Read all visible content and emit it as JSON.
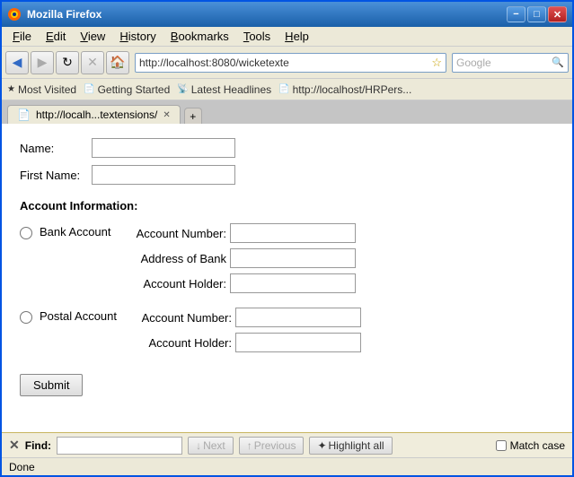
{
  "window": {
    "title": "Mozilla Firefox",
    "minimize_label": "−",
    "maximize_label": "□",
    "close_label": "✕"
  },
  "menu": {
    "items": [
      {
        "label": "File"
      },
      {
        "label": "Edit"
      },
      {
        "label": "View"
      },
      {
        "label": "History"
      },
      {
        "label": "Bookmarks"
      },
      {
        "label": "Tools"
      },
      {
        "label": "Help"
      }
    ]
  },
  "toolbar": {
    "address": "http://localhost:8080/wicketexte",
    "search_placeholder": "Google"
  },
  "bookmarks": {
    "items": [
      {
        "label": "Most Visited",
        "icon": "★"
      },
      {
        "label": "Getting Started",
        "icon": "📄"
      },
      {
        "label": "Latest Headlines",
        "icon": "📡"
      },
      {
        "label": "http://localhost/HRPers...",
        "icon": "📄"
      }
    ]
  },
  "tab": {
    "label": "http://localh...textensions/",
    "close": "✕"
  },
  "form": {
    "name_label": "Name:",
    "first_name_label": "First Name:",
    "account_info_label": "Account Information:",
    "bank_account_label": "Bank Account",
    "postal_account_label": "Postal Account",
    "account_number_label": "Account Number:",
    "address_of_bank_label": "Address of Bank",
    "account_holder_label": "Account Holder:",
    "submit_label": "Submit"
  },
  "find_bar": {
    "close": "✕",
    "label": "Find:",
    "next_label": "Next",
    "previous_label": "Previous",
    "highlight_label": "Highlight all",
    "match_case_label": "Match case",
    "next_arrow": "↓",
    "prev_arrow": "↑",
    "highlight_icon": "✦"
  },
  "status": {
    "text": "Done"
  }
}
